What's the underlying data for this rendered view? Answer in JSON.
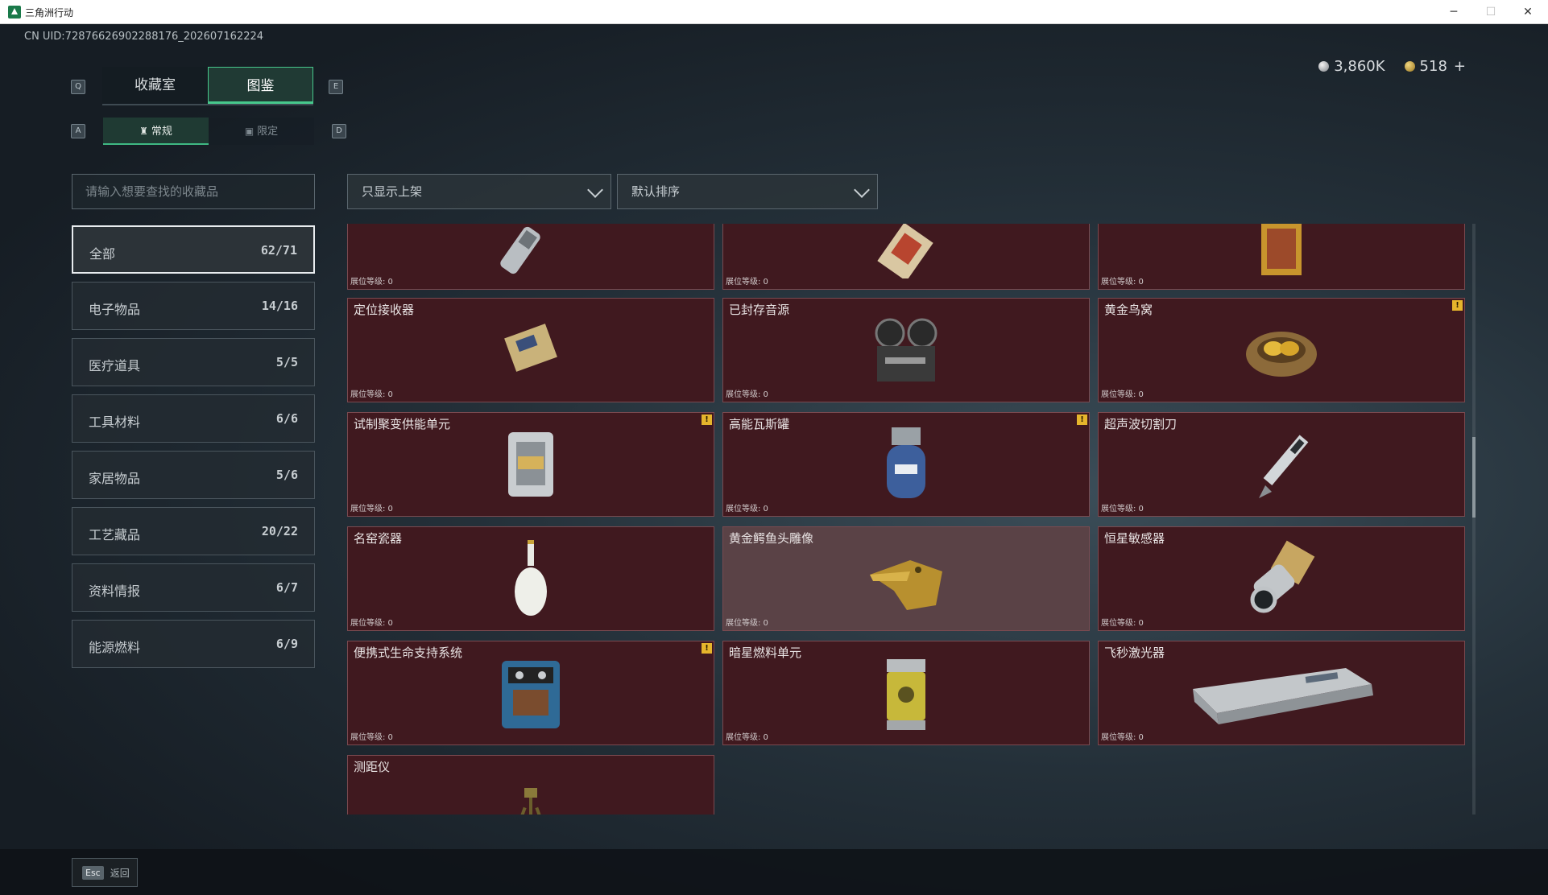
{
  "window": {
    "title": "三角洲行动",
    "minimize": "─",
    "maximize": "☐",
    "close": "✕"
  },
  "uid": "CN UID:7287662690228817​6_202607162224",
  "currency": {
    "silver": "3,860K",
    "gold": "518",
    "plus": "+"
  },
  "keys": {
    "prev_tab": "Q",
    "next_tab": "E",
    "prev_sub": "A",
    "next_sub": "D"
  },
  "tabs": [
    {
      "label": "收藏室"
    },
    {
      "label": "图鉴"
    }
  ],
  "subtabs": [
    {
      "label": "常规",
      "icon": "♜"
    },
    {
      "label": "限定",
      "icon": "▣"
    }
  ],
  "search": {
    "placeholder": "请输入想要查找的收藏品"
  },
  "filters": {
    "display": "只显示上架",
    "sort": "默认排序"
  },
  "categories": [
    {
      "name": "全部",
      "count": "62/71"
    },
    {
      "name": "电子物品",
      "count": "14/16"
    },
    {
      "name": "医疗道具",
      "count": "5/5"
    },
    {
      "name": "工具材料",
      "count": "6/6"
    },
    {
      "name": "家居物品",
      "count": "5/6"
    },
    {
      "name": "工艺藏品",
      "count": "20/22"
    },
    {
      "name": "资料情报",
      "count": "6/7"
    },
    {
      "name": "能源燃料",
      "count": "6/9"
    }
  ],
  "level_label": "展位等级: 0",
  "items": [
    {
      "name": "",
      "icon": "flashlight-icon"
    },
    {
      "name": "",
      "icon": "ornate-box-icon"
    },
    {
      "name": "",
      "icon": "painting-icon"
    },
    {
      "name": "定位接收器",
      "icon": "receiver-icon"
    },
    {
      "name": "已封存音源",
      "icon": "reel-recorder-icon"
    },
    {
      "name": "黄金鸟窝",
      "icon": "golden-nest-icon"
    },
    {
      "name": "试制聚变供能单元",
      "icon": "fusion-unit-icon"
    },
    {
      "name": "高能瓦斯罐",
      "icon": "gas-canister-icon"
    },
    {
      "name": "超声波切割刀",
      "icon": "ultrasonic-knife-icon"
    },
    {
      "name": "名窑瓷器",
      "icon": "porcelain-vase-icon"
    },
    {
      "name": "黄金鳄鱼头雕像",
      "icon": "golden-crocodile-icon"
    },
    {
      "name": "恒星敏感器",
      "icon": "star-sensor-icon"
    },
    {
      "name": "便携式生命支持系统",
      "icon": "life-support-icon"
    },
    {
      "name": "暗星燃料单元",
      "icon": "fuel-cell-icon"
    },
    {
      "name": "飞秒激光器",
      "icon": "laser-device-icon"
    },
    {
      "name": "测距仪",
      "icon": "rangefinder-icon"
    }
  ],
  "alert_mark": "!",
  "back": {
    "key": "Esc",
    "label": "返回"
  }
}
